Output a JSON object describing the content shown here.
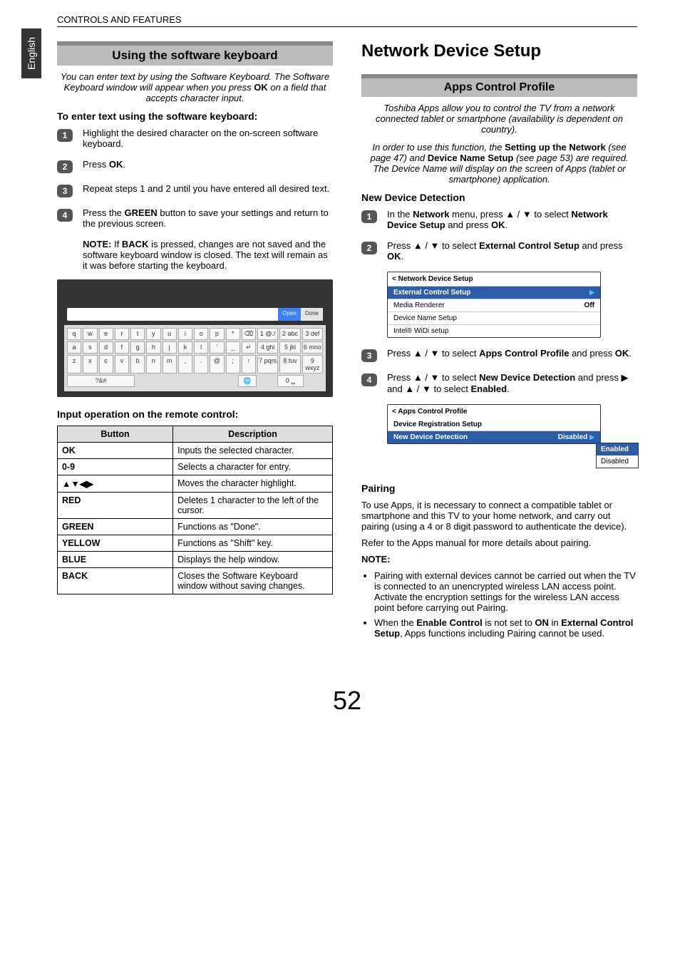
{
  "lang_tab": "English",
  "header": "CONTROLS AND FEATURES",
  "page_number": "52",
  "left": {
    "section_title": "Using the software keyboard",
    "intro_line1": "You can enter text by using the Software Keyboard. The Software Keyboard window will appear when you press ",
    "intro_ok": "OK",
    "intro_line2": " on a field that accepts character input.",
    "enter_heading": "To enter text using the software keyboard:",
    "steps": {
      "s1": "Highlight the desired character on the on-screen software keyboard.",
      "s2_a": "Press ",
      "s2_b": "OK",
      "s2_c": ".",
      "s3": "Repeat steps 1 and 2 until you have entered all desired text.",
      "s4_a": "Press the ",
      "s4_b": "GREEN",
      "s4_c": " button to save your settings and return to the previous screen."
    },
    "note_a": "NOTE: ",
    "note_b": "If ",
    "note_c": "BACK",
    "note_d": " is pressed, changes are not saved and the software keyboard window is closed. The text will remain as it was before starting the keyboard.",
    "osk": {
      "open": "Open",
      "done": "Done",
      "row1": [
        "q",
        "w",
        "e",
        "r",
        "t",
        "y",
        "u",
        "i",
        "o",
        "p",
        "*",
        "⌫",
        "1 @./",
        "2 abc",
        "3 def"
      ],
      "row2": [
        "a",
        "s",
        "d",
        "f",
        "g",
        "h",
        "j",
        "k",
        "l",
        "'",
        "_",
        "↵",
        "4 ghi",
        "5 jkl",
        "6 mno"
      ],
      "row3": [
        "z",
        "x",
        "c",
        "v",
        "b",
        "n",
        "m",
        ",",
        ".",
        "@",
        ";",
        "↑",
        "7 pqrs",
        "8 tuv",
        "9 wxyz"
      ],
      "row4_left": "?&#",
      "row4_globe": "🌐",
      "row4_zero": "0 ␣"
    },
    "input_heading": "Input operation on the remote control:",
    "table": {
      "h1": "Button",
      "h2": "Description",
      "rows": [
        {
          "b": "OK",
          "d": "Inputs the selected character."
        },
        {
          "b": "0-9",
          "d": "Selects a character for entry."
        },
        {
          "b": "▲▼◀▶",
          "d": "Moves the character highlight."
        },
        {
          "b": "RED",
          "d": "Deletes 1 character to the left of the cursor."
        },
        {
          "b": "GREEN",
          "d": "Functions as \"Done\"."
        },
        {
          "b": "YELLOW",
          "d": "Functions as \"Shift\" key."
        },
        {
          "b": "BLUE",
          "d": "Displays the help window."
        },
        {
          "b": "BACK",
          "d": "Closes the Software Keyboard window without saving changes."
        }
      ]
    }
  },
  "right": {
    "title": "Network Device Setup",
    "sub": "Apps Control Profile",
    "intro": "Toshiba Apps allow you to control the TV from a network connected tablet or smartphone (availability is dependent on country).",
    "req_a": "In order to use this function, the ",
    "req_b": "Setting up the Network",
    "req_c": " (see page 47) and ",
    "req_d": "Device Name Setup",
    "req_e": " (see page 53) are required. The Device Name will display on the screen of Apps (tablet or smartphone) application.",
    "ndd_heading": "New Device Detection",
    "ndd": {
      "s1_a": "In the ",
      "s1_b": "Network",
      "s1_c": " menu, press ▲ / ▼ to select ",
      "s1_d": "Network Device Setup",
      "s1_e": " and press ",
      "s1_f": "OK",
      "s1_g": ".",
      "s2_a": "Press ▲ / ▼ to select ",
      "s2_b": "External Control Setup",
      "s2_c": " and press ",
      "s2_d": "OK",
      "s2_e": ".",
      "s3_a": "Press ▲ / ▼ to select ",
      "s3_b": "Apps Control Profile",
      "s3_c": " and press ",
      "s3_d": "OK",
      "s3_e": ".",
      "s4_a": "Press ▲ / ▼ to select ",
      "s4_b": "New Device Detection",
      "s4_c": " and press ▶ and ▲ / ▼ to select ",
      "s4_d": "Enabled",
      "s4_e": "."
    },
    "panel1": {
      "title": "< Network Device Setup",
      "r1": "External Control Setup",
      "r2": "Media Renderer",
      "r2_v": "Off",
      "r3": "Device Name Setup",
      "r4": "Intel® WiDi setup"
    },
    "panel2": {
      "title": "< Apps Control Profile",
      "r1": "Device Registration Setup",
      "r2": "New Device Detection",
      "r2_v": "Disabled",
      "dd1": "Enabled",
      "dd2": "Disabled"
    },
    "pairing_heading": "Pairing",
    "pairing_body1": "To use Apps, it is necessary to connect a compatible tablet or smartphone and this TV to your home network, and carry out pairing (using a 4 or 8 digit password to authenticate the device).",
    "pairing_body2": "Refer to the Apps manual for more details about pairing.",
    "note_label": "NOTE:",
    "note1": "Pairing with external devices cannot be carried out when the TV is connected to an unencrypted wireless LAN access point. Activate the encryption settings for the wireless LAN access point before carrying out Pairing.",
    "note2_a": "When the ",
    "note2_b": "Enable Control",
    "note2_c": " is not set to ",
    "note2_d": "ON",
    "note2_e": " in ",
    "note2_f": "External Control Setup",
    "note2_g": ", Apps functions including Pairing cannot be used."
  }
}
